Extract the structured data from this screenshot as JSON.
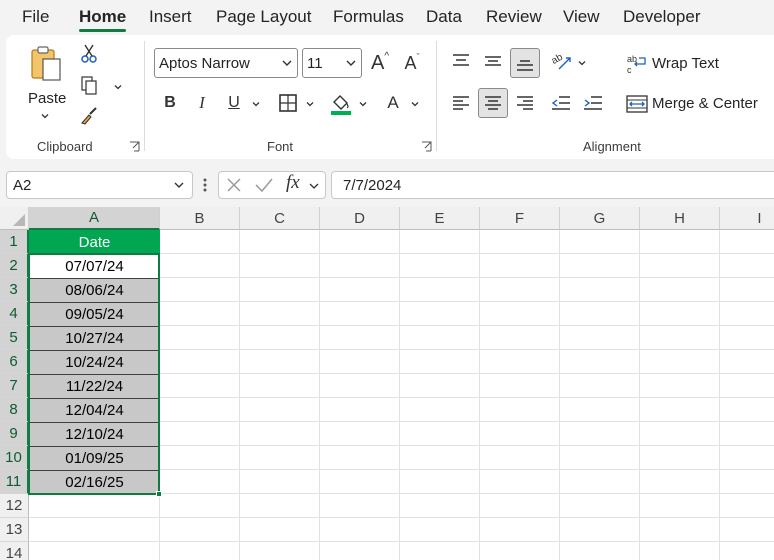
{
  "menu": {
    "tabs": [
      "File",
      "Home",
      "Insert",
      "Page Layout",
      "Formulas",
      "Data",
      "Review",
      "View",
      "Developer"
    ],
    "active": "Home"
  },
  "ribbon": {
    "clipboard": {
      "paste_label": "Paste",
      "group_label": "Clipboard"
    },
    "font": {
      "font_name": "Aptos Narrow",
      "font_size": "11",
      "group_label": "Font",
      "bold": "B",
      "italic": "I",
      "underline": "U",
      "grow": "A",
      "shrink": "A",
      "font_color": "A"
    },
    "alignment": {
      "wrap_text": "Wrap Text",
      "merge_center": "Merge & Center",
      "group_label": "Alignment"
    }
  },
  "formula_bar": {
    "name_box": "A2",
    "fx_label": "fx",
    "formula": "7/7/2024"
  },
  "sheet": {
    "columns": [
      "A",
      "B",
      "C",
      "D",
      "E",
      "F",
      "G",
      "H",
      "I"
    ],
    "rows": [
      "1",
      "2",
      "3",
      "4",
      "5",
      "6",
      "7",
      "8",
      "9",
      "10",
      "11",
      "12",
      "13",
      "14"
    ],
    "header_cell": "Date",
    "dates": [
      "07/07/24",
      "08/06/24",
      "09/05/24",
      "10/27/24",
      "10/24/24",
      "11/22/24",
      "12/04/24",
      "12/10/24",
      "01/09/25",
      "02/16/25"
    ],
    "colors": {
      "accent": "#107c41",
      "header_fill": "#00a651",
      "data_fill": "#c8c8c8"
    }
  }
}
